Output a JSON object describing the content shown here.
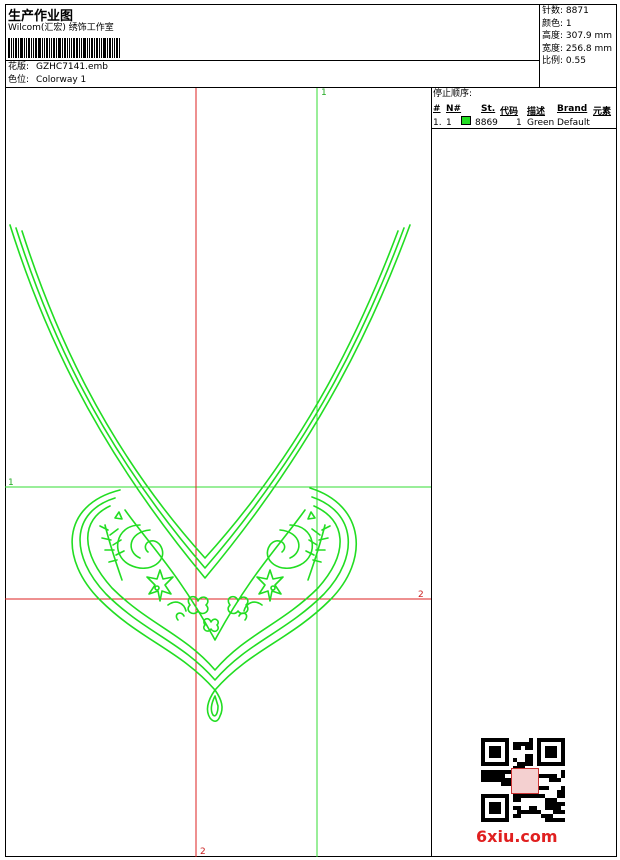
{
  "header": {
    "title": "生产作业图",
    "company": "Wilcom(汇宏) 绣饰工作室",
    "design_label": "花版:",
    "design_file": "GZHC7141.emb",
    "colorway_label": "色位:",
    "colorway_name": "Colorway 1"
  },
  "stats": {
    "stitches": "针数: 8871",
    "colors": "颜色: 1",
    "height": "高度: 307.9 mm",
    "width": "宽度: 256.8 mm",
    "scale": "比例: 0.55"
  },
  "stop_sequence": {
    "title": "停止顺序:",
    "headers": {
      "num": "#",
      "n": "N#",
      "stitches": "St.",
      "code": "代码",
      "desc": "描述",
      "brand": "Brand",
      "element": "元素"
    },
    "rows": [
      {
        "num": "1.",
        "n": "1",
        "stitches": "8869",
        "code": "1",
        "desc": "Green",
        "brand": "Default",
        "color": "#22dd22"
      }
    ]
  },
  "guides": {
    "green_v": "1",
    "green_h": "1",
    "red_h": "2",
    "red_v": "2"
  },
  "colors": {
    "stitch": "#22dd22",
    "guide_green": "#33dd33",
    "guide_red": "#dd2222"
  },
  "watermark": "6xiu.com"
}
